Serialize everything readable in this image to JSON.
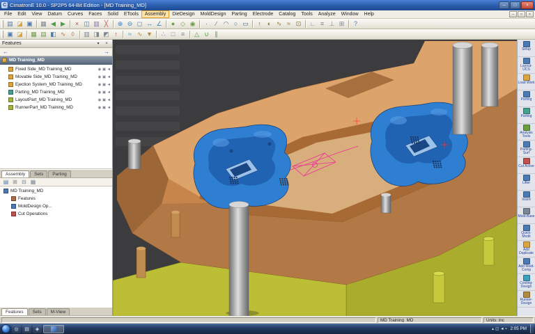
{
  "colors": {
    "viewport_bg": "#3c3c3e",
    "mold_orange": "#c8854b",
    "insert_blue": "#2e7fd2",
    "base_yellow": "#bcbf36",
    "accent_blue": "#2a5cab"
  },
  "window": {
    "app_icon_letter": "C",
    "title": "CimatronE 10.0 - SP2P5 64-Bit Edition - [MD Training_MD]",
    "controls": {
      "minimize": "─",
      "maximize": "□",
      "close": "×"
    }
  },
  "menu": {
    "items": [
      "File",
      "Edit",
      "View",
      "Datum",
      "Curves",
      "Faces",
      "Solid",
      "ETools",
      "Assembly",
      "DieDesign",
      "MoldDesign",
      "Parting",
      "Electrode",
      "Catalog",
      "Tools",
      "Analyze",
      "Window",
      "Help"
    ],
    "active": "Assembly",
    "mdi_controls": [
      "─",
      "□",
      "×"
    ]
  },
  "toolbar_main": {
    "icons": [
      {
        "n": "new-file",
        "g": "▤",
        "c": "#4a7ab5"
      },
      {
        "n": "open-file",
        "g": "◪",
        "c": "#d9a441"
      },
      {
        "n": "save-file",
        "g": "▣",
        "c": "#4a7ab5"
      },
      "|",
      {
        "n": "print",
        "g": "▦",
        "c": "#7b8794"
      },
      {
        "n": "undo",
        "g": "◀",
        "c": "#4a9e4a"
      },
      {
        "n": "redo",
        "g": "▶",
        "c": "#4a9e4a"
      },
      "|",
      {
        "n": "cut",
        "g": "×",
        "c": "#b05050"
      },
      {
        "n": "copy",
        "g": "◫",
        "c": "#4a7ab5"
      },
      {
        "n": "paste",
        "g": "▥",
        "c": "#8a6fb0"
      },
      {
        "n": "delete",
        "g": "╳",
        "c": "#c05050"
      },
      "|",
      {
        "n": "zoom-in",
        "g": "⊕",
        "c": "#3f7fbf"
      },
      {
        "n": "zoom-out",
        "g": "⊖",
        "c": "#3f7fbf"
      },
      {
        "n": "zoom-fit",
        "g": "◻",
        "c": "#3f7fbf"
      },
      {
        "n": "pan",
        "g": "↔",
        "c": "#3f7fbf"
      },
      {
        "n": "rotate-view",
        "g": "∠",
        "c": "#3f7fbf"
      },
      "|",
      {
        "n": "shaded-view",
        "g": "●",
        "c": "#6a9e3f"
      },
      {
        "n": "wireframe-view",
        "g": "◇",
        "c": "#6a9e3f"
      },
      {
        "n": "hide-show",
        "g": "◉",
        "c": "#6a9e3f"
      },
      "|",
      {
        "n": "point",
        "g": "·",
        "c": "#3f6fa0"
      },
      {
        "n": "line",
        "g": "∕",
        "c": "#3f6fa0"
      },
      {
        "n": "arc",
        "g": "◠",
        "c": "#3f6fa0"
      },
      {
        "n": "circle",
        "g": "○",
        "c": "#3f6fa0"
      },
      {
        "n": "rectangle",
        "g": "▭",
        "c": "#3f6fa0"
      },
      "|",
      {
        "n": "extrude",
        "g": "↑",
        "c": "#8a6f3f"
      },
      {
        "n": "revolve",
        "g": "◐",
        "c": "#8a6f3f"
      },
      {
        "n": "sweep",
        "g": "∿",
        "c": "#8a6f3f"
      },
      {
        "n": "loft",
        "g": "≈",
        "c": "#8a6f3f"
      },
      {
        "n": "shell",
        "g": "⊡",
        "c": "#8a6f3f"
      },
      "|",
      {
        "n": "measure",
        "g": "∟",
        "c": "#7b8794"
      },
      {
        "n": "layers",
        "g": "≡",
        "c": "#7b8794"
      },
      {
        "n": "ucs",
        "g": "⊥",
        "c": "#7b8794"
      },
      {
        "n": "grid",
        "g": "⊞",
        "c": "#7b8794"
      },
      "|",
      {
        "n": "help",
        "g": "?",
        "c": "#4a7ab5"
      }
    ]
  },
  "toolbar_mold": {
    "icons": [
      {
        "n": "mold-project",
        "g": "▣",
        "c": "#4a7ab5"
      },
      {
        "n": "data-import",
        "g": "◪",
        "c": "#d9a441"
      },
      "|",
      {
        "n": "workpiece",
        "g": "▦",
        "c": "#6a9e3f"
      },
      {
        "n": "layout",
        "g": "▤",
        "c": "#6a9e3f"
      },
      {
        "n": "cavity-core",
        "g": "◧",
        "c": "#4a7ab5"
      },
      {
        "n": "parting-line",
        "g": "∿",
        "c": "#b0703f"
      },
      {
        "n": "parting-surface",
        "g": "◊",
        "c": "#b0703f"
      },
      "|",
      {
        "n": "mold-base",
        "g": "▥",
        "c": "#7b8794"
      },
      {
        "n": "slider",
        "g": "◨",
        "c": "#7b8794"
      },
      {
        "n": "lifter",
        "g": "◩",
        "c": "#7b8794"
      },
      {
        "n": "ejector",
        "g": "↑",
        "c": "#b05050"
      },
      "|",
      {
        "n": "cooling",
        "g": "≈",
        "c": "#3f9fbf"
      },
      {
        "n": "runner",
        "g": "∿",
        "c": "#b08a3f"
      },
      {
        "n": "gate",
        "g": "▼",
        "c": "#b08a3f"
      },
      "|",
      {
        "n": "electrode-tool",
        "g": "∴",
        "c": "#8a6fb0"
      },
      {
        "n": "drawing",
        "g": "□",
        "c": "#7b8794"
      },
      {
        "n": "bom",
        "g": "≡",
        "c": "#7b8794"
      },
      "|",
      {
        "n": "analyze-draft",
        "g": "△",
        "c": "#4a9e4a"
      },
      {
        "n": "analyze-undercut",
        "g": "∪",
        "c": "#4a9e4a"
      },
      {
        "n": "analyze-thickness",
        "g": "∥",
        "c": "#4a9e4a"
      }
    ]
  },
  "left_panel": {
    "header": {
      "title": "Features",
      "pin": "▾",
      "close": "×"
    },
    "nav": {
      "back": "←",
      "forward": "→"
    },
    "root_item": {
      "label": "MD Training_MD"
    },
    "tree_items": [
      {
        "label": "Fixed Side_MD Training_MD",
        "icon_color": "#e0a33c"
      },
      {
        "label": "Movable Side_MD Training_MD",
        "icon_color": "#e0a33c"
      },
      {
        "label": "Ejection System_MD Training_MD",
        "icon_color": "#e0a33c"
      },
      {
        "label": "Parting_MD Training_MD",
        "icon_color": "#45a08f"
      },
      {
        "label": "LayoutPart_MD Training_MD",
        "icon_color": "#a8b23e"
      },
      {
        "label": "RunnerPart_MD Training_MD",
        "icon_color": "#a8b23e"
      }
    ],
    "row_badges": [
      "◉",
      "▣",
      "◄"
    ],
    "mid_tabs": {
      "items": [
        "Assembly",
        "Sets",
        "Parting"
      ],
      "active": "Assembly"
    },
    "panel2_icons": [
      {
        "n": "tree-filter",
        "g": "▤",
        "c": "#4a7ab5"
      },
      {
        "n": "expand-all",
        "g": "⊞",
        "c": "#7b8794"
      },
      {
        "n": "collapse-all",
        "g": "⊟",
        "c": "#7b8794"
      },
      {
        "n": "tree-options",
        "g": "▦",
        "c": "#7b8794"
      }
    ],
    "assembly_tree": [
      {
        "label": "MD Training_MD",
        "icon_color": "#4a7ab5",
        "indent": 0
      },
      {
        "label": "Features",
        "icon_color": "#b06a4a",
        "indent": 1
      },
      {
        "label": "MoldDesign Op...",
        "icon_color": "#4a7ab5",
        "indent": 1
      },
      {
        "label": "Cut Operations",
        "icon_color": "#c05050",
        "indent": 1
      }
    ],
    "bottom_tabs": {
      "items": [
        "Features",
        "Sets",
        "M-View"
      ],
      "active": "Features"
    }
  },
  "right_toolbar": {
    "items": [
      {
        "label": "Setup",
        "icon_color": "#4a7ab5"
      },
      {
        "label": "Layout-UCS",
        "icon_color": "#4a7ab5"
      },
      {
        "label": "Load Work",
        "icon_color": "#d9a441"
      },
      {
        "label": "Parting",
        "icon_color": "#4a7ab5"
      },
      {
        "label": "Parting",
        "icon_color": "#45a08f"
      },
      {
        "label": "Analysis Tools",
        "icon_color": "#6a9e3f"
      },
      {
        "label": "Parting-Surf",
        "icon_color": "#4a7ab5"
      },
      {
        "label": "Cut Active",
        "icon_color": "#c05050"
      },
      {
        "label": "Lifter",
        "icon_color": "#4a7ab5"
      },
      {
        "label": "Insert",
        "icon_color": "#4a7ab5"
      },
      {
        "label": "Mold-Base",
        "icon_color": "#7b8794"
      },
      {
        "label": "Quick-Modit",
        "icon_color": "#4a7ab5"
      },
      {
        "label": "Add Duplicate",
        "icon_color": "#d9a441"
      },
      {
        "label": "Add Mold-Comp",
        "icon_color": "#4a7ab5"
      },
      {
        "label": "Cooling-Design",
        "icon_color": "#3f9fbf"
      },
      {
        "label": "Runner-Design",
        "icon_color": "#b08a3f"
      }
    ]
  },
  "status_bar": {
    "document": "MD Training_MD",
    "units": "Units: inc"
  },
  "taskbar": {
    "quick_icons": [
      "◎",
      "▤",
      "◈"
    ],
    "tray_icons": [
      "▴",
      "◫",
      "◄",
      "▪"
    ],
    "clock": "2:05 PM"
  }
}
